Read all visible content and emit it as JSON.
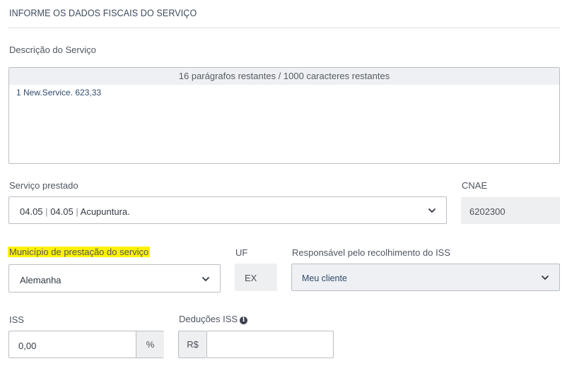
{
  "section": {
    "title": "INFORME OS DADOS FISCAIS DO SERVIÇO"
  },
  "description": {
    "label": "Descrição do Serviço",
    "counter": "16 parágrafos restantes / 1000 caracteres restantes",
    "text": "1 New.Service. 623,33"
  },
  "servico": {
    "label": "Serviço prestado",
    "code1": "04.05",
    "code2": "04.05",
    "name": "Acupuntura.",
    "separator": "|"
  },
  "cnae": {
    "label": "CNAE",
    "value": "6202300"
  },
  "municipio": {
    "label": "Município de prestação do serviço",
    "value": "Alemanha",
    "highlight_color": "#fff200"
  },
  "uf": {
    "label": "UF",
    "value": "EX"
  },
  "responsavel": {
    "label": "Responsável pelo recolhimento do ISS",
    "value": "Meu cliente"
  },
  "iss": {
    "label": "ISS",
    "value": "0,00",
    "suffix": "%"
  },
  "deducoes": {
    "label": "Deduções ISS",
    "prefix": "R$",
    "value": ""
  },
  "icons": {
    "dropdown": "chevron-down-icon",
    "info": "info-icon"
  }
}
